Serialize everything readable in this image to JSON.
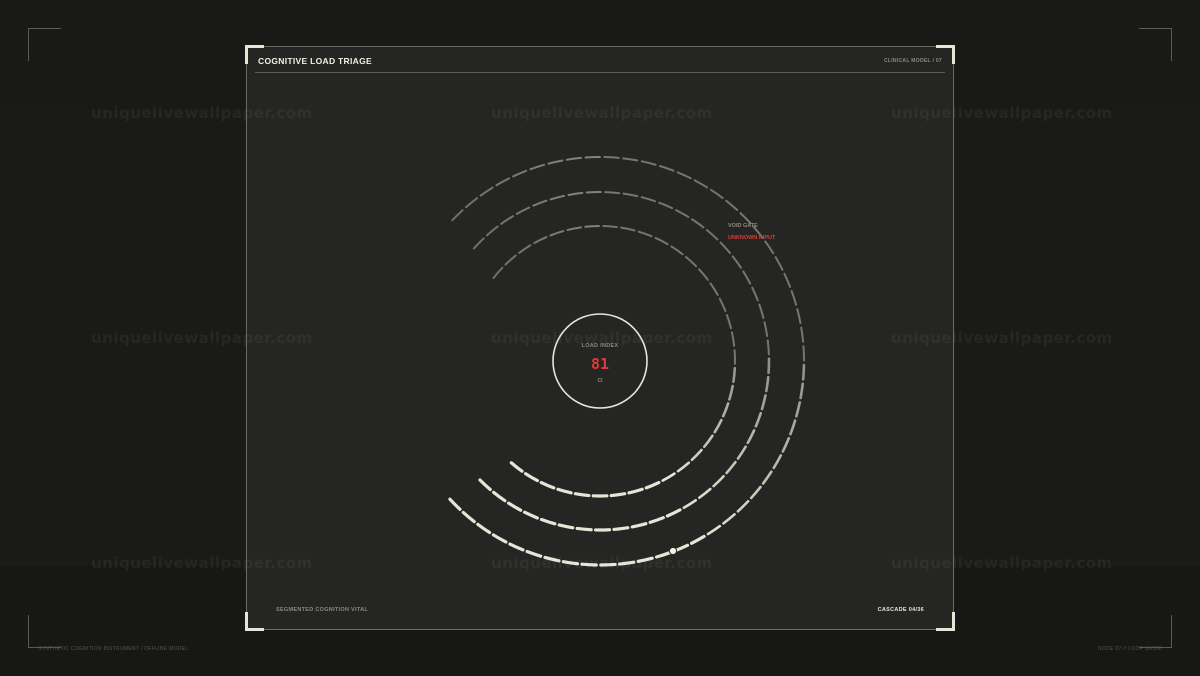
{
  "panel": {
    "title": "COGNITIVE LOAD TRIAGE",
    "tag": "CLINICAL MODEL / 07",
    "footer_left": "SEGMENTED COGNITION VITAL",
    "footer_right": "CASCADE 04/36"
  },
  "gauge": {
    "center_label": "LOAD INDEX",
    "value": "81",
    "unit": "CI",
    "void_label": "VOID GATE",
    "void_status": "UNKNOWN INPUT",
    "marker_label": "load-marker"
  },
  "page_footer": {
    "left": "SYNTHETIC COGNITION INSTRUMENT / OFFLINE MODEL",
    "right": "NODE 07 // LOOP 36/360"
  },
  "watermark": {
    "text": "uniquelivewallpaper.com"
  },
  "colors": {
    "background": "#1a1a18",
    "panel": "#252523",
    "segment": "#e8e4d6",
    "accent": "#e03a3a"
  }
}
